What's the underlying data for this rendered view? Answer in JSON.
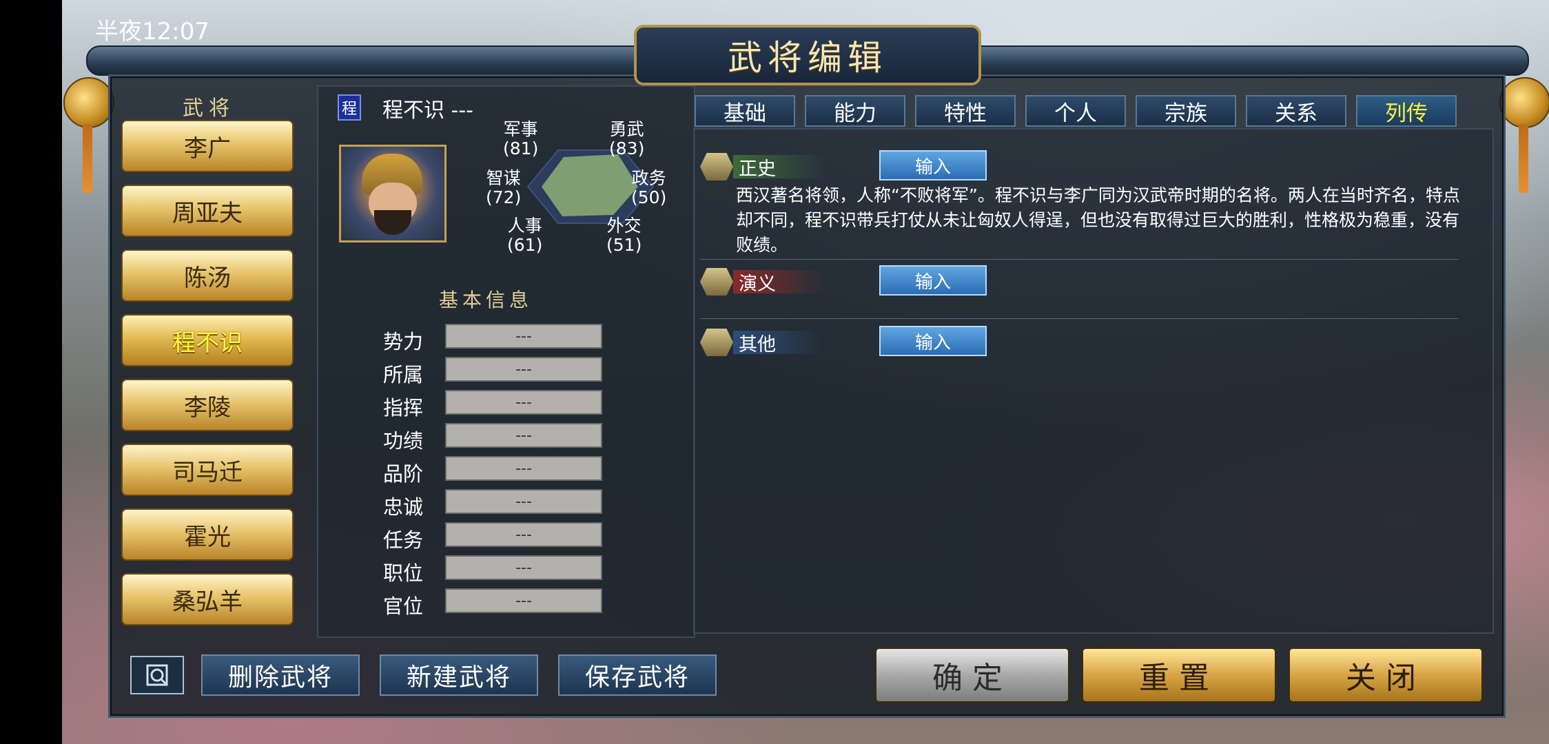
{
  "status": {
    "time": "半夜12:07"
  },
  "window": {
    "title": "武将编辑"
  },
  "sidebar": {
    "header": "武将",
    "generals": [
      "李广",
      "周亚夫",
      "陈汤",
      "程不识",
      "李陵",
      "司马迁",
      "霍光",
      "桑弘羊"
    ],
    "selected": "程不识"
  },
  "profile": {
    "tag": "程",
    "name_line": "程不识 ---",
    "stats": [
      {
        "label": "军事",
        "value": "(81)"
      },
      {
        "label": "勇武",
        "value": "(83)"
      },
      {
        "label": "智谋",
        "value": "(72)"
      },
      {
        "label": "政务",
        "value": "(50)"
      },
      {
        "label": "人事",
        "value": "(61)"
      },
      {
        "label": "外交",
        "value": "(51)"
      }
    ],
    "basic_title": "基本信息",
    "fields": [
      {
        "label": "势力",
        "value": "---"
      },
      {
        "label": "所属",
        "value": "---"
      },
      {
        "label": "指挥",
        "value": "---"
      },
      {
        "label": "功绩",
        "value": "---"
      },
      {
        "label": "品阶",
        "value": "---"
      },
      {
        "label": "忠诚",
        "value": "---"
      },
      {
        "label": "任务",
        "value": "---"
      },
      {
        "label": "职位",
        "value": "---"
      },
      {
        "label": "官位",
        "value": "---"
      }
    ]
  },
  "tabs": [
    "基础",
    "能力",
    "特性",
    "个人",
    "宗族",
    "关系",
    "列传"
  ],
  "active_tab": "列传",
  "sections": [
    {
      "label": "正史",
      "button": "输入",
      "text": "西汉著名将领，人称“不败将军”。程不识与李广同为汉武帝时期的名将。两人在当时齐名，特点却不同，程不识带兵打仗从未让匈奴人得逞，但也没有取得过巨大的胜利，性格极为稳重，没有败绩。"
    },
    {
      "label": "演义",
      "button": "输入",
      "text": ""
    },
    {
      "label": "其他",
      "button": "输入",
      "text": ""
    }
  ],
  "bottom": {
    "delete": "删除武将",
    "new": "新建武将",
    "save": "保存武将",
    "confirm": "确定",
    "reset": "重置",
    "close": "关闭"
  },
  "colors": {
    "gold": "#e7c46c",
    "active_text": "#fffb3a",
    "tab_bg": "#1b2f47",
    "input_btn": "#2c6cb3"
  }
}
